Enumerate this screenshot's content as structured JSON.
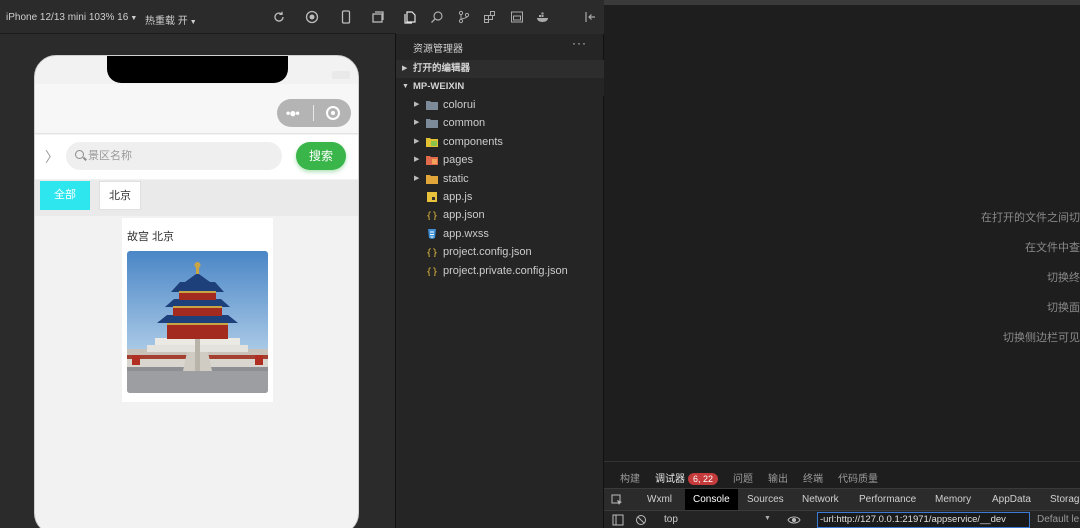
{
  "simulator": {
    "device_label": "iPhone 12/13 mini 103% 16",
    "hot_reload_label": "热重载 开"
  },
  "miniapp": {
    "search": {
      "placeholder": "景区名称",
      "button_label": "搜索"
    },
    "filters": [
      {
        "label": "全部",
        "active": true
      },
      {
        "label": "北京",
        "active": false
      }
    ],
    "card": {
      "title": "故宫 北京"
    }
  },
  "explorer": {
    "title": "资源管理器",
    "more": "···",
    "open_editors": "打开的编辑器",
    "project": "MP-WEIXIN",
    "items": [
      {
        "name": "colorui",
        "type": "folder"
      },
      {
        "name": "common",
        "type": "folder"
      },
      {
        "name": "components",
        "type": "folder-components"
      },
      {
        "name": "pages",
        "type": "folder-pages"
      },
      {
        "name": "static",
        "type": "folder-static"
      },
      {
        "name": "app.js",
        "type": "js"
      },
      {
        "name": "app.json",
        "type": "json"
      },
      {
        "name": "app.wxss",
        "type": "css"
      },
      {
        "name": "project.config.json",
        "type": "json"
      },
      {
        "name": "project.private.config.json",
        "type": "json"
      }
    ]
  },
  "editor": {
    "hints": [
      "在打开的文件之间切",
      "在文件中查",
      "切换终",
      "切换面",
      "切换侧边栏可见"
    ]
  },
  "panel": {
    "tabs": [
      {
        "label": "构建",
        "active": false
      },
      {
        "label": "调试器",
        "active": true,
        "badge": "6, 22"
      },
      {
        "label": "问题",
        "active": false
      },
      {
        "label": "输出",
        "active": false
      },
      {
        "label": "终端",
        "active": false
      },
      {
        "label": "代码质量",
        "active": false
      }
    ],
    "devtools_tabs": [
      "Wxml",
      "Console",
      "Sources",
      "Network",
      "Performance",
      "Memory",
      "AppData",
      "Storag"
    ],
    "active_devtools_tab": "Console",
    "context": "top",
    "filter_value": "-url:http://127.0.0.1:21971/appservice/__dev",
    "levels": "Default le"
  },
  "colors": {
    "accent_green": "#39b54a",
    "chip_active": "#2ee6ee",
    "badge_red": "#c53b3b"
  }
}
